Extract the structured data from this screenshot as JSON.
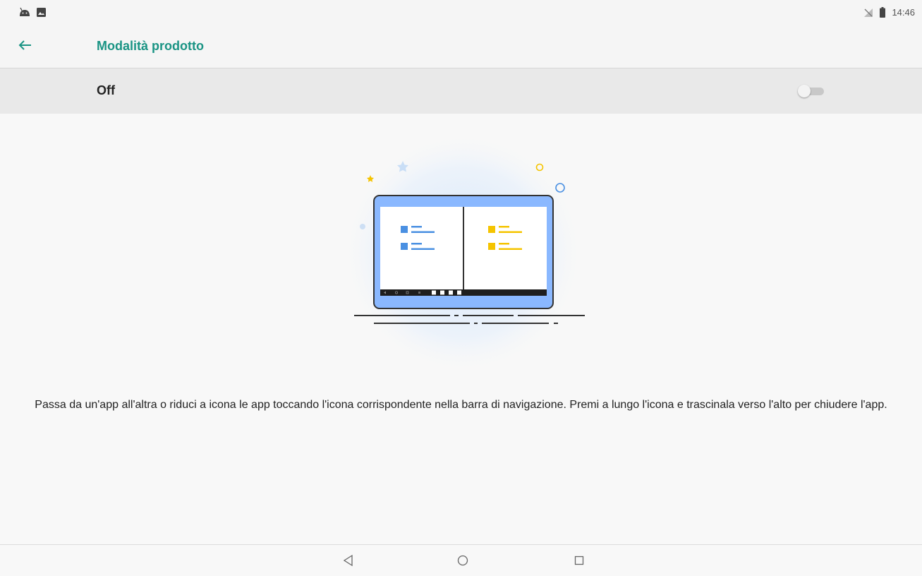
{
  "status_bar": {
    "time": "14:46",
    "left_icons": [
      "android-icon",
      "image-icon"
    ],
    "right_icons": [
      "no-sim-icon",
      "battery-icon"
    ]
  },
  "app_bar": {
    "back_icon": "arrow-left-icon",
    "title": "Modalità prodotto"
  },
  "toggle": {
    "label": "Off",
    "state": "off"
  },
  "description": "Passa da un'app all'altra o riduci a icona le app toccando l'icona corrispondente nella barra di navigazione. Premi a lungo l'icona e trascinala verso l'alto per chiudere l'app.",
  "nav_bar": {
    "buttons": [
      "back-triangle-icon",
      "home-circle-icon",
      "recents-square-icon"
    ]
  },
  "colors": {
    "accent": "#1a9484",
    "blue": "#4a90e2",
    "yellow": "#f5c400",
    "tablet_frame": "#8ab8ff"
  }
}
